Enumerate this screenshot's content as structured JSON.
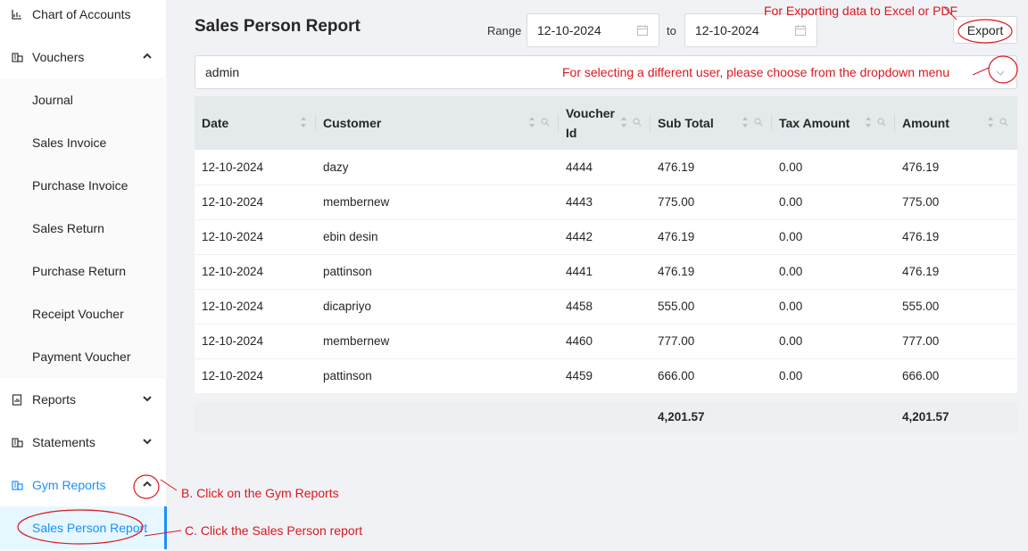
{
  "sidebar": {
    "items": [
      {
        "label": "Chart of Accounts",
        "icon": "bar-chart-icon"
      },
      {
        "label": "Vouchers",
        "icon": "vouchers-icon",
        "expanded": true
      },
      {
        "label": "Reports",
        "icon": "reports-icon",
        "expanded": false
      },
      {
        "label": "Statements",
        "icon": "statements-icon",
        "expanded": false
      },
      {
        "label": "Gym Reports",
        "icon": "gym-reports-icon",
        "expanded": true
      }
    ],
    "voucher_subitems": [
      "Journal",
      "Sales Invoice",
      "Purchase Invoice",
      "Sales Return",
      "Purchase Return",
      "Receipt Voucher",
      "Payment Voucher"
    ],
    "gym_subitems": [
      "Sales Person Report"
    ]
  },
  "header": {
    "title": "Sales Person Report",
    "range_label": "Range",
    "from_date": "12-10-2024",
    "to_label": "to",
    "to_date": "12-10-2024",
    "export_label": "Export"
  },
  "user_select": {
    "value": "admin"
  },
  "table": {
    "columns": [
      "Date",
      "Customer",
      "Voucher Id",
      "Sub Total",
      "Tax Amount",
      "Amount"
    ],
    "rows": [
      [
        "12-10-2024",
        "dazy",
        "4444",
        "476.19",
        "0.00",
        "476.19"
      ],
      [
        "12-10-2024",
        "membernew",
        "4443",
        "775.00",
        "0.00",
        "775.00"
      ],
      [
        "12-10-2024",
        "ebin desin",
        "4442",
        "476.19",
        "0.00",
        "476.19"
      ],
      [
        "12-10-2024",
        "pattinson",
        "4441",
        "476.19",
        "0.00",
        "476.19"
      ],
      [
        "12-10-2024",
        "dicapriyo",
        "4458",
        "555.00",
        "0.00",
        "555.00"
      ],
      [
        "12-10-2024",
        "membernew",
        "4460",
        "777.00",
        "0.00",
        "777.00"
      ],
      [
        "12-10-2024",
        "pattinson",
        "4459",
        "666.00",
        "0.00",
        "666.00"
      ]
    ],
    "summary": {
      "sub_total": "4,201.57",
      "amount": "4,201.57"
    }
  },
  "annotations": {
    "export_note": "For Exporting data to Excel or PDF",
    "dropdown_note": "For selecting a different user, please choose from the dropdown menu",
    "gym_note": "B.  Click on the Gym Reports",
    "report_note": "C. Click the Sales Person report",
    "color": "#d9181f"
  },
  "colors": {
    "accent": "#1890ff",
    "header_bg": "#e4e9ec"
  }
}
